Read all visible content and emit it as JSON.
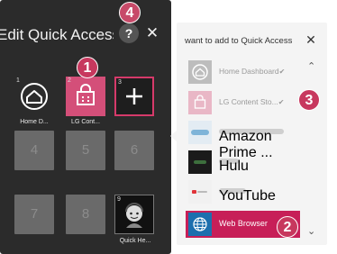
{
  "left_panel": {
    "title": "Edit Quick Access",
    "help_label": "?",
    "close_label": "✕",
    "tiles": [
      {
        "num": "1",
        "caption": "Home D...",
        "icon": "home-icon"
      },
      {
        "num": "2",
        "caption": "LG Cont...",
        "icon": "shopping-bag-icon"
      },
      {
        "num": "3",
        "caption": "",
        "icon": "plus-icon"
      },
      {
        "num": "4"
      },
      {
        "num": "5"
      },
      {
        "num": "6"
      },
      {
        "num": "7"
      },
      {
        "num": "8"
      },
      {
        "num": "9",
        "caption": "Quick He...",
        "icon": "agent-face-icon"
      }
    ]
  },
  "right_panel": {
    "title": "want to add to Quick Access",
    "close_label": "✕",
    "items": [
      {
        "label": "Home Dashboard",
        "checked": "✔",
        "icon": "home-icon"
      },
      {
        "label": "LG Content Sto...",
        "checked": "✔",
        "icon": "shopping-bag-icon"
      },
      {
        "label": "Amazon Prime ...",
        "icon": "prime-video-icon"
      },
      {
        "label": "Hulu",
        "icon": "hulu-icon"
      },
      {
        "label": "YouTube",
        "icon": "youtube-icon"
      },
      {
        "label": "Web Browser",
        "icon": "globe-icon"
      }
    ],
    "scroll_up": "⌃",
    "scroll_down": "⌄"
  },
  "badges": {
    "b1": "1",
    "b2": "2",
    "b3": "3",
    "b4": "4"
  },
  "colors": {
    "accent": "#c71f58",
    "badge": "#c7385e",
    "panel_dark": "#2b2b2b"
  }
}
